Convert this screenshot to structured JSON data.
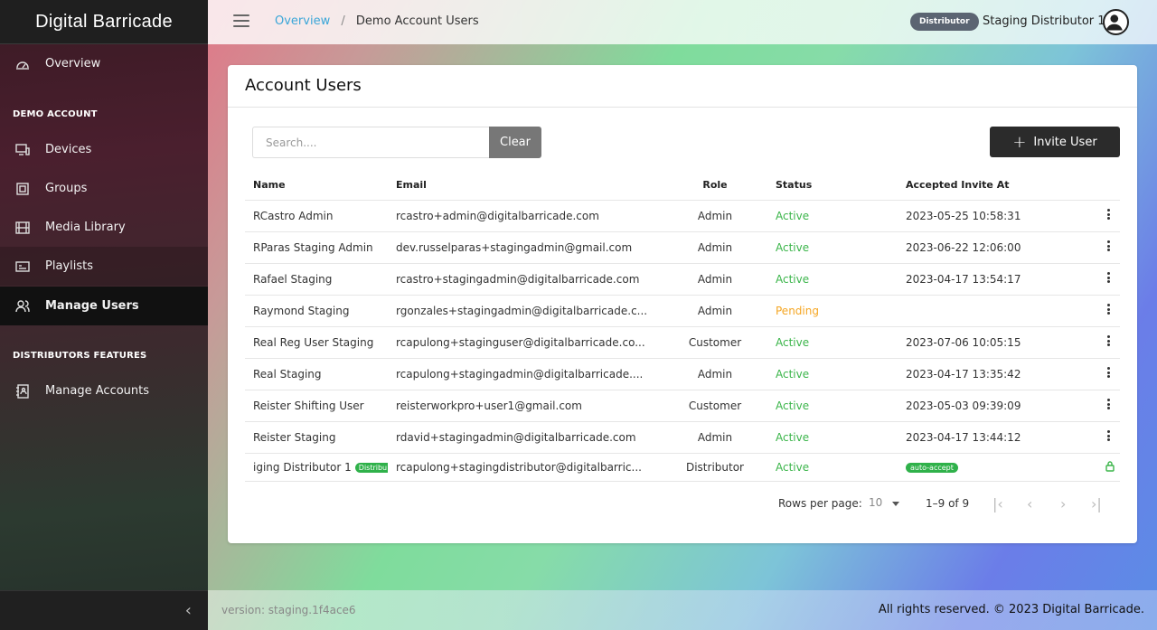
{
  "sidebar": {
    "brand": "Digital Barricade",
    "overview": "Overview",
    "section_demo": "DEMO ACCOUNT",
    "devices": "Devices",
    "groups": "Groups",
    "media_library": "Media Library",
    "playlists": "Playlists",
    "manage_users": "Manage Users",
    "section_dist": "DISTRIBUTORS FEATURES",
    "manage_accounts": "Manage Accounts",
    "collapse_icon": "chevron-left-icon"
  },
  "topbar": {
    "breadcrumb_link": "Overview",
    "breadcrumb_sep": "/",
    "breadcrumb_current": "Demo Account Users",
    "role_badge": "Distributor",
    "user_name": "Staging Distributor 1"
  },
  "card": {
    "title": "Account Users",
    "search_placeholder": "Search....",
    "clear_label": "Clear",
    "invite_label": "Invite User"
  },
  "table": {
    "headers": [
      "Name",
      "Email",
      "Role",
      "Status",
      "Accepted Invite At"
    ],
    "rows": [
      {
        "name": "RCastro Admin",
        "email": "rcastro+admin@digitalbarricade.com",
        "role": "Admin",
        "status": "Active",
        "accepted": "2023-05-25 10:58:31"
      },
      {
        "name": "RParas Staging Admin",
        "email": "dev.russelparas+stagingadmin@gmail.com",
        "role": "Admin",
        "status": "Active",
        "accepted": "2023-06-22 12:06:00"
      },
      {
        "name": "Rafael Staging",
        "email": "rcastro+stagingadmin@digitalbarricade.com",
        "role": "Admin",
        "status": "Active",
        "accepted": "2023-04-17 13:54:17"
      },
      {
        "name": "Raymond Staging",
        "email": "rgonzales+stagingadmin@digitalbarricade.c...",
        "role": "Admin",
        "status": "Pending",
        "accepted": ""
      },
      {
        "name": "Real Reg User Staging",
        "email": "rcapulong+staginguser@digitalbarricade.co...",
        "role": "Customer",
        "status": "Active",
        "accepted": "2023-07-06 10:05:15"
      },
      {
        "name": "Real Staging",
        "email": "rcapulong+stagingadmin@digitalbarricade....",
        "role": "Admin",
        "status": "Active",
        "accepted": "2023-04-17 13:35:42"
      },
      {
        "name": "Reister Shifting User",
        "email": "reisterworkpro+user1@gmail.com",
        "role": "Customer",
        "status": "Active",
        "accepted": "2023-05-03 09:39:09"
      },
      {
        "name": "Reister Staging",
        "email": "rdavid+stagingadmin@digitalbarricade.com",
        "role": "Admin",
        "status": "Active",
        "accepted": "2023-04-17 13:44:12"
      },
      {
        "name": "iging Distributor 1",
        "name_badge": "Distribu",
        "email": "rcapulong+stagingdistributor@digitalbarric...",
        "role": "Distributor",
        "status": "Active",
        "accepted": "auto-accept"
      }
    ]
  },
  "pagination": {
    "rows_per_page_label": "Rows per page:",
    "rows_per_page": "10",
    "range": "1–9 of 9"
  },
  "footer": {
    "version": "version: staging.1f4ace6",
    "rights": "All rights reserved. © 2023 Digital Barricade."
  },
  "colors": {
    "active": "#3bb54a",
    "pending": "#f5a623",
    "link": "#3aa6d8"
  }
}
